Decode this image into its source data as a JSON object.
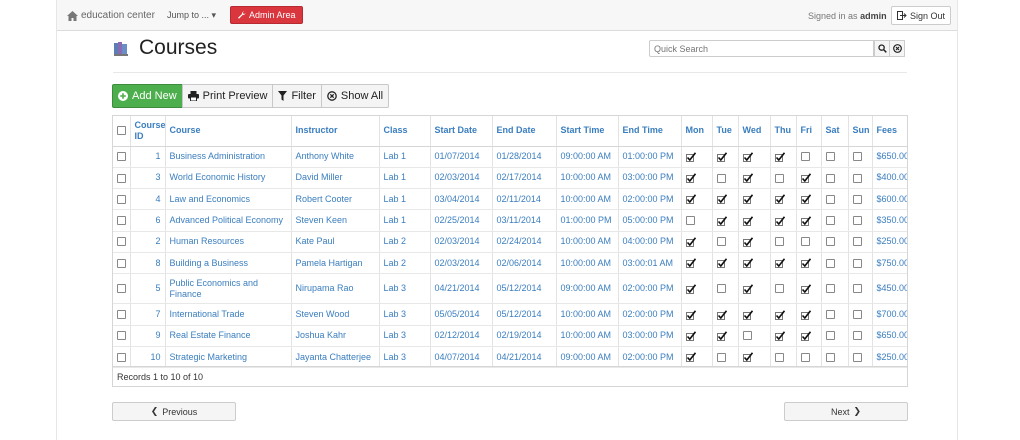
{
  "navbar": {
    "brand": "education center",
    "jump_to": "Jump to ...",
    "admin_area": "Admin Area",
    "signed_in_prefix": "Signed in as",
    "username": "admin",
    "sign_out": "Sign Out"
  },
  "page": {
    "title": "Courses",
    "search_placeholder": "Quick Search"
  },
  "toolbar": {
    "add_new": "Add New",
    "print_preview": "Print Preview",
    "filter": "Filter",
    "show_all": "Show All"
  },
  "table": {
    "headers": [
      "Course ID",
      "Course",
      "Instructor",
      "Class",
      "Start Date",
      "End Date",
      "Start Time",
      "End Time",
      "Mon",
      "Tue",
      "Wed",
      "Thu",
      "Fri",
      "Sat",
      "Sun",
      "Fees"
    ],
    "rows": [
      {
        "id": "1",
        "course": "Business Administration",
        "instructor": "Anthony White",
        "class": "Lab 1",
        "start_date": "01/07/2014",
        "end_date": "01/28/2014",
        "start_time": "09:00:00 AM",
        "end_time": "01:00:00 PM",
        "days": [
          true,
          true,
          true,
          true,
          false,
          false,
          false
        ],
        "fees": "$650.00"
      },
      {
        "id": "3",
        "course": "World Economic History",
        "instructor": "David Miller",
        "class": "Lab 1",
        "start_date": "02/03/2014",
        "end_date": "02/17/2014",
        "start_time": "10:00:00 AM",
        "end_time": "03:00:00 PM",
        "days": [
          true,
          false,
          true,
          false,
          true,
          false,
          false
        ],
        "fees": "$400.00"
      },
      {
        "id": "4",
        "course": "Law and Economics",
        "instructor": "Robert Cooter",
        "class": "Lab 1",
        "start_date": "03/04/2014",
        "end_date": "02/11/2014",
        "start_time": "10:00:00 AM",
        "end_time": "02:00:00 PM",
        "days": [
          true,
          true,
          true,
          true,
          true,
          false,
          false
        ],
        "fees": "$600.00"
      },
      {
        "id": "6",
        "course": "Advanced Political Economy",
        "instructor": "Steven Keen",
        "class": "Lab 1",
        "start_date": "02/25/2014",
        "end_date": "03/11/2014",
        "start_time": "01:00:00 PM",
        "end_time": "05:00:00 PM",
        "days": [
          false,
          true,
          true,
          true,
          true,
          false,
          false
        ],
        "fees": "$350.00"
      },
      {
        "id": "2",
        "course": "Human Resources",
        "instructor": "Kate Paul",
        "class": "Lab 2",
        "start_date": "02/03/2014",
        "end_date": "02/24/2014",
        "start_time": "10:00:00 AM",
        "end_time": "04:00:00 PM",
        "days": [
          true,
          false,
          true,
          false,
          false,
          false,
          false
        ],
        "fees": "$250.00"
      },
      {
        "id": "8",
        "course": "Building a Business",
        "instructor": "Pamela Hartigan",
        "class": "Lab 2",
        "start_date": "02/03/2014",
        "end_date": "02/06/2014",
        "start_time": "10:00:00 AM",
        "end_time": "03:00:01 AM",
        "days": [
          true,
          true,
          true,
          true,
          true,
          false,
          false
        ],
        "fees": "$750.00"
      },
      {
        "id": "5",
        "course": "Public Economics and Finance",
        "instructor": "Nirupama Rao",
        "class": "Lab 3",
        "start_date": "04/21/2014",
        "end_date": "05/12/2014",
        "start_time": "09:00:00 AM",
        "end_time": "02:00:00 PM",
        "days": [
          true,
          false,
          true,
          false,
          true,
          false,
          false
        ],
        "fees": "$450.00"
      },
      {
        "id": "7",
        "course": "International Trade",
        "instructor": "Steven Wood",
        "class": "Lab 3",
        "start_date": "05/05/2014",
        "end_date": "05/12/2014",
        "start_time": "10:00:00 AM",
        "end_time": "02:00:00 PM",
        "days": [
          true,
          true,
          true,
          true,
          true,
          false,
          false
        ],
        "fees": "$700.00"
      },
      {
        "id": "9",
        "course": "Real Estate Finance",
        "instructor": "Joshua Kahr",
        "class": "Lab 3",
        "start_date": "02/12/2014",
        "end_date": "02/19/2014",
        "start_time": "10:00:00 AM",
        "end_time": "03:00:00 PM",
        "days": [
          true,
          true,
          false,
          true,
          true,
          false,
          false
        ],
        "fees": "$650.00"
      },
      {
        "id": "10",
        "course": "Strategic Marketing",
        "instructor": "Jayanta Chatterjee",
        "class": "Lab 3",
        "start_date": "04/07/2014",
        "end_date": "04/21/2014",
        "start_time": "09:00:00 AM",
        "end_time": "02:00:00 PM",
        "days": [
          true,
          false,
          true,
          false,
          false,
          false,
          false
        ],
        "fees": "$250.00"
      }
    ],
    "records_text": "Records 1 to 10 of 10"
  },
  "pager": {
    "previous": "Previous",
    "next": "Next"
  },
  "colors": {
    "link": "#3a7ebf",
    "add_new": "#4cae4c",
    "admin_area": "#d9363e"
  }
}
